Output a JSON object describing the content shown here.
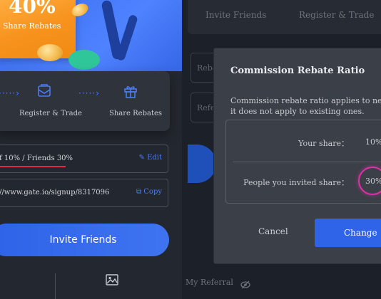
{
  "left_panel": {
    "promo": {
      "percent": "40%",
      "label": "Share Rebates"
    },
    "steps": [
      {
        "icon": "envelope-icon",
        "label": "Register & Trade"
      },
      {
        "icon": "gift-icon",
        "label": "Share Rebates"
      }
    ],
    "ratio_field": {
      "value": "f 10% / Friends 30%",
      "action": "Edit"
    },
    "link_field": {
      "value": "//www.gate.io/signup/8317096",
      "action": "Copy"
    },
    "invite_button": "Invite Friends"
  },
  "right_panel": {
    "tabs": [
      "Invite Friends",
      "Register & Trade"
    ],
    "background_labels": [
      "Reba",
      "Refe"
    ],
    "my_referral": "My Referral",
    "modal": {
      "title": "Commission Rebate Ratio",
      "description_line1": "Commission rebate ratio applies to new r",
      "description_line2": "it does not apply to existing ones.",
      "your_share_label": "Your share：",
      "your_share_value": "10%",
      "invited_share_label": "People you invited share：",
      "invited_share_value": "30%",
      "cancel_label": "Cancel",
      "change_label": "Change"
    }
  },
  "colors": {
    "accent_blue": "#2f63e8",
    "promo_orange": "#f7931e",
    "highlight_pink": "#e12fa8",
    "underline_red": "#e02d3c"
  }
}
